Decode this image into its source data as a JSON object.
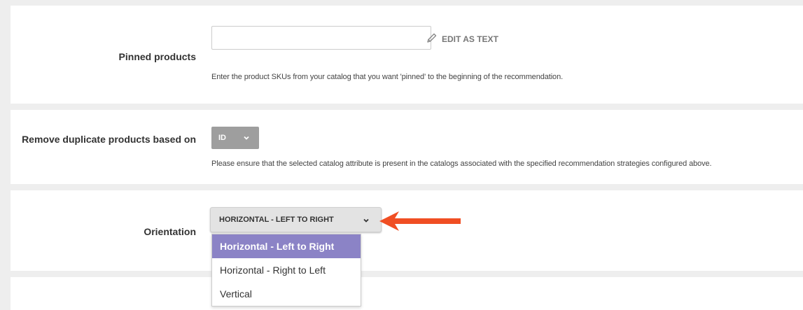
{
  "pinned": {
    "label": "Pinned products",
    "input_value": "",
    "edit_as_text": "EDIT AS TEXT",
    "help": "Enter the product SKUs from your catalog that you want 'pinned' to the beginning of the recommendation."
  },
  "dedupe": {
    "label": "Remove duplicate products based on",
    "selected": "ID",
    "help": "Please ensure that the selected catalog attribute is present in the catalogs associated with the specified recommendation strategies configured above."
  },
  "orientation": {
    "label": "Orientation",
    "selected": "HORIZONTAL - LEFT TO RIGHT",
    "options": [
      "Horizontal - Left to Right",
      "Horizontal - Right to Left",
      "Vertical"
    ]
  },
  "colors": {
    "highlight": "#8b83c6",
    "arrow": "#f04e23",
    "dropdown_gray": "#9e9e9e"
  },
  "icons": {
    "edit": "pencil-icon",
    "dropdown": "chevron-down-icon",
    "pointer": "red-arrow-icon"
  }
}
